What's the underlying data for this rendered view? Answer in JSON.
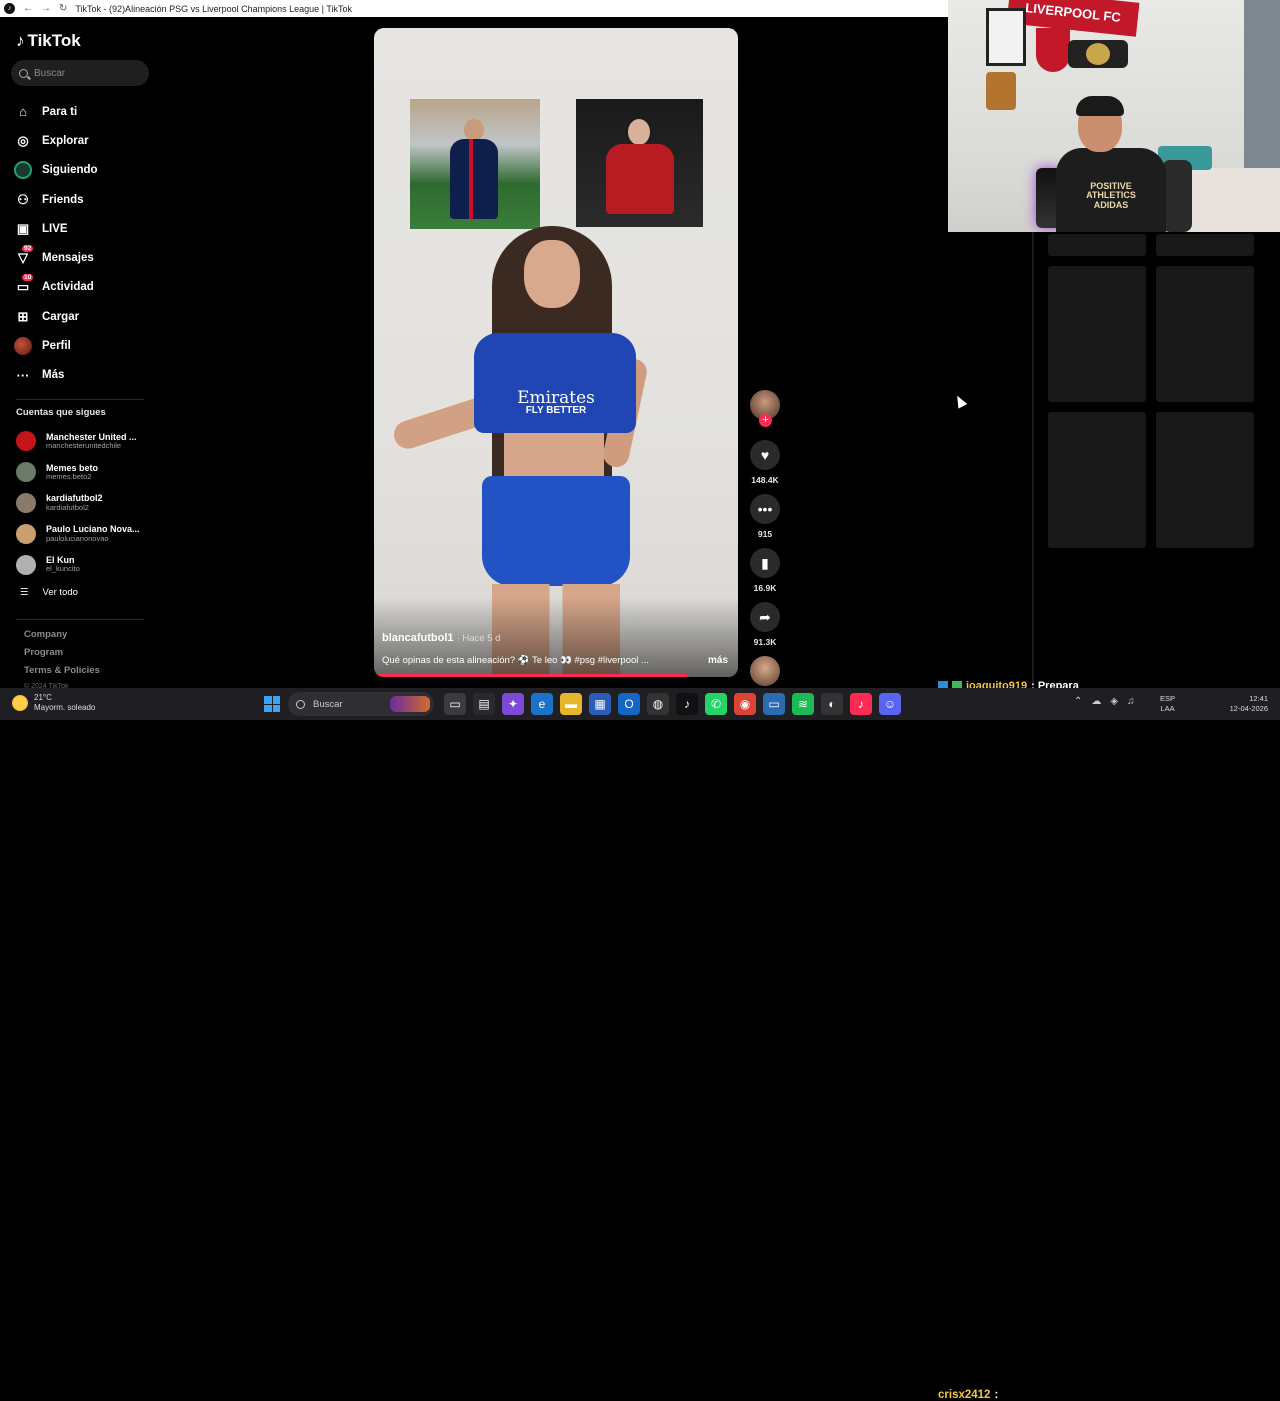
{
  "browser": {
    "tab_title": "TikTok - (92)Alineación PSG vs Liverpool Champions League | TikTok"
  },
  "tiktok": {
    "logo": "TikTok",
    "search_placeholder": "Buscar",
    "nav": [
      {
        "label": "Para ti",
        "icon": "home-icon"
      },
      {
        "label": "Explorar",
        "icon": "compass-icon"
      },
      {
        "label": "Siguiendo",
        "icon": "following-icon"
      },
      {
        "label": "Friends",
        "icon": "friends-icon"
      },
      {
        "label": "LIVE",
        "icon": "live-icon"
      },
      {
        "label": "Mensajes",
        "icon": "messages-icon",
        "badge": "92"
      },
      {
        "label": "Actividad",
        "icon": "activity-icon",
        "badge": "10"
      },
      {
        "label": "Cargar",
        "icon": "upload-icon"
      },
      {
        "label": "Perfil",
        "icon": "profile-avatar"
      },
      {
        "label": "Más",
        "icon": "more-icon"
      }
    ],
    "following_title": "Cuentas que sigues",
    "following": [
      {
        "name": "Manchester United ...",
        "handle": "manchesterunitedchile",
        "color": "#c4151c"
      },
      {
        "name": "Memes beto",
        "handle": "memes.beto2",
        "color": "#6b7b6a"
      },
      {
        "name": "kardiafutbol2",
        "handle": "kardiafutbol2",
        "color": "#8a7a6a"
      },
      {
        "name": "Paulo Luciano Nova...",
        "handle": "paulolucianonovao",
        "color": "#c8a070"
      },
      {
        "name": "El Kun",
        "handle": "el_kuncito",
        "color": "#b0b0b0"
      }
    ],
    "see_all": "Ver todo",
    "footer": [
      "Company",
      "Program",
      "Terms & Policies"
    ],
    "copyright": "© 2024 TikTok"
  },
  "video": {
    "username": "blancafutbol1",
    "time": "· Hace 5 d",
    "caption": "Qué opinas de esta alineación? ⚽ Te leo 👀 #psg #liverpool ...",
    "more": "más",
    "sponsor_top": "Emirates",
    "sponsor_bottom": "FLY BETTER",
    "progress": 0.86
  },
  "actions": {
    "likes": "148.4K",
    "comments": "915",
    "saves": "16.9K",
    "shares": "91.3K"
  },
  "webcam": {
    "banner": "LIVERPOOL FC",
    "shirt_text": "POSITIVE ATHLETICS ADIDAS"
  },
  "chat": {
    "user1": "joaquito919",
    "msg1": ": Prepara",
    "user2": "crisx2412",
    "msg2": ":"
  },
  "taskbar": {
    "temp": "21°C",
    "weather": "Mayorm. soleado",
    "search": "Buscar",
    "lang1": "ESP",
    "lang2": "LAA",
    "time": "12:41",
    "date": "12-04-2026"
  }
}
